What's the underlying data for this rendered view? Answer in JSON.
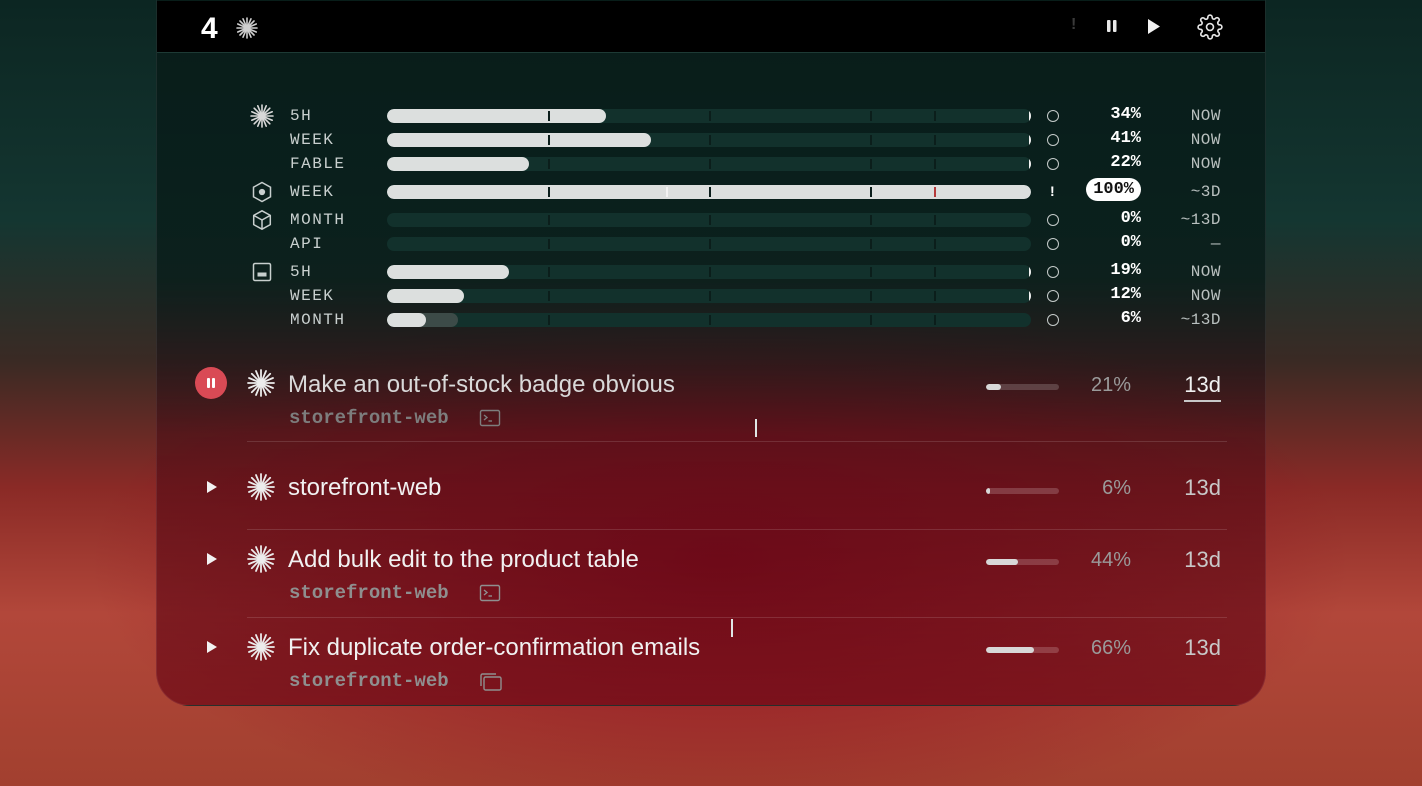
{
  "header": {
    "count": "4",
    "icons": [
      "sparkle-icon",
      "alert-icon",
      "pause-icon",
      "play-icon",
      "gear-icon"
    ],
    "alert_mark": "!"
  },
  "usage": {
    "rows": [
      {
        "icon": "sparkle-icon",
        "label": "5H",
        "fill": 0.34,
        "pct": "34%",
        "time": "NOW",
        "status": "circle"
      },
      {
        "icon": "",
        "label": "WEEK",
        "fill": 0.41,
        "pct": "41%",
        "time": "NOW",
        "status": "circle"
      },
      {
        "icon": "",
        "label": "FABLE",
        "fill": 0.22,
        "pct": "22%",
        "time": "NOW",
        "status": "circle"
      },
      {
        "icon": "hexagon-icon",
        "label": "WEEK",
        "fill": 1.0,
        "pct": "100%",
        "time": "~3D",
        "status": "alert"
      },
      {
        "icon": "cube-icon",
        "label": "MONTH",
        "fill": 0.0,
        "pct": "0%",
        "time": "~13D",
        "status": "circle"
      },
      {
        "icon": "",
        "label": "API",
        "fill": 0.0,
        "pct": "0%",
        "time": "—",
        "status": "circle"
      },
      {
        "icon": "terminal-box-icon",
        "label": "5H",
        "fill": 0.19,
        "pct": "19%",
        "time": "NOW",
        "status": "circle"
      },
      {
        "icon": "",
        "label": "WEEK",
        "fill": 0.12,
        "pct": "12%",
        "time": "NOW",
        "status": "circle"
      },
      {
        "icon": "",
        "label": "MONTH",
        "fill": 0.06,
        "pct": "6%",
        "time": "~13D",
        "status": "circle"
      }
    ],
    "alert_mark": "!"
  },
  "tasks": [
    {
      "state": "paused",
      "title": "Make an out-of-stock badge obvious",
      "repo": "storefront-web",
      "repo_icon": "terminal-icon",
      "progress": 0.21,
      "pct": "21%",
      "age": "13d"
    },
    {
      "state": "idle",
      "title": "storefront-web",
      "repo": "",
      "repo_icon": "",
      "progress": 0.06,
      "pct": "6%",
      "age": "13d"
    },
    {
      "state": "idle",
      "title": "Add bulk edit to the product table",
      "repo": "storefront-web",
      "repo_icon": "terminal-icon",
      "progress": 0.44,
      "pct": "44%",
      "age": "13d"
    },
    {
      "state": "idle",
      "title": "Fix duplicate order-confirmation emails",
      "repo": "storefront-web",
      "repo_icon": "windows-icon",
      "progress": 0.66,
      "pct": "66%",
      "age": "13d"
    }
  ],
  "colors": {
    "accent_red": "#d94a55",
    "bar_fill": "#dcdfde",
    "track": "#12312c"
  }
}
